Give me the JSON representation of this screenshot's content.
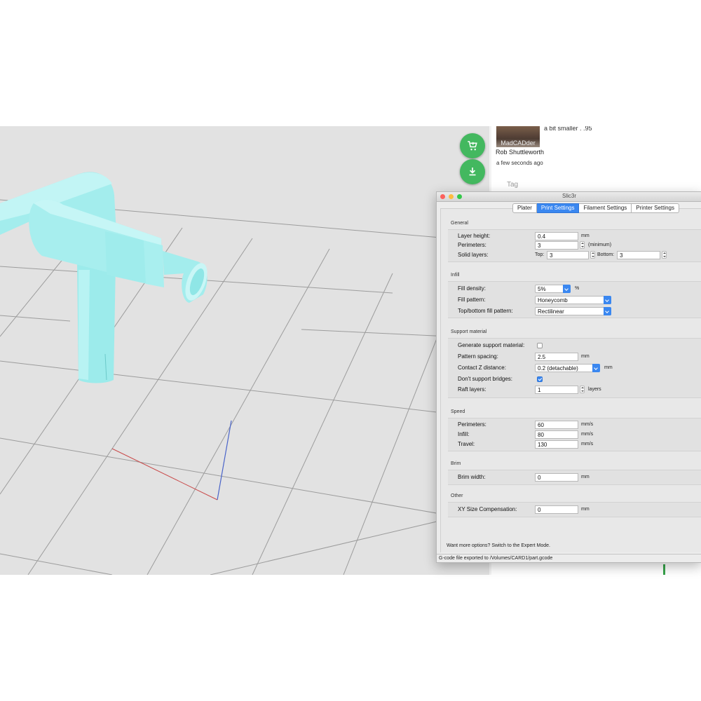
{
  "comment": {
    "avatar_label": "MadCADder",
    "text": "a bit smaller . .95",
    "author": "Rob Shuttleworth",
    "time": "a few seconds ago",
    "tag_placeholder": "Tag"
  },
  "actions": {
    "add_to_cart_icon": "cart-plus-icon",
    "download_icon": "download-icon"
  },
  "window": {
    "title": "Slic3r",
    "tabs": [
      {
        "label": "Plater"
      },
      {
        "label": "Print Settings"
      },
      {
        "label": "Filament Settings"
      },
      {
        "label": "Printer Settings"
      }
    ],
    "active_tab": "Print Settings",
    "status": "G-code file exported to /Volumes/CARD1/part.gcode"
  },
  "settings": {
    "general": {
      "title": "General",
      "layer_height_label": "Layer height:",
      "layer_height_value": "0.4",
      "layer_height_unit": "mm",
      "perimeters_label": "Perimeters:",
      "perimeters_value": "3",
      "perimeters_unit": "(minimum)",
      "solid_layers_label": "Solid layers:",
      "top_label": "Top:",
      "top_value": "3",
      "bottom_label": "Bottom:",
      "bottom_value": "3"
    },
    "infill": {
      "title": "Infill",
      "density_label": "Fill density:",
      "density_value": "5%",
      "density_unit": "%",
      "pattern_label": "Fill pattern:",
      "pattern_value": "Honeycomb",
      "topbottom_label": "Top/bottom fill pattern:",
      "topbottom_value": "Rectilinear"
    },
    "support": {
      "title": "Support material",
      "generate_label": "Generate support material:",
      "generate_checked": false,
      "spacing_label": "Pattern spacing:",
      "spacing_value": "2.5",
      "spacing_unit": "mm",
      "contact_label": "Contact Z distance:",
      "contact_value": "0.2 (detachable)",
      "contact_unit": "mm",
      "bridges_label": "Don't support bridges:",
      "bridges_checked": true,
      "raft_label": "Raft layers:",
      "raft_value": "1",
      "raft_unit": "layers"
    },
    "speed": {
      "title": "Speed",
      "perimeters_label": "Perimeters:",
      "perimeters_value": "60",
      "infill_label": "Infill:",
      "infill_value": "80",
      "travel_label": "Travel:",
      "travel_value": "130",
      "unit": "mm/s"
    },
    "brim": {
      "title": "Brim",
      "width_label": "Brim width:",
      "width_value": "0",
      "unit": "mm"
    },
    "other": {
      "title": "Other",
      "xy_label": "XY Size Compensation:",
      "xy_value": "0",
      "unit": "mm"
    },
    "hint": "Want more options? Switch to the Expert Mode."
  },
  "colors": {
    "model": "#a8eeee",
    "accent": "#3a87f0",
    "fab": "#43b85f"
  }
}
